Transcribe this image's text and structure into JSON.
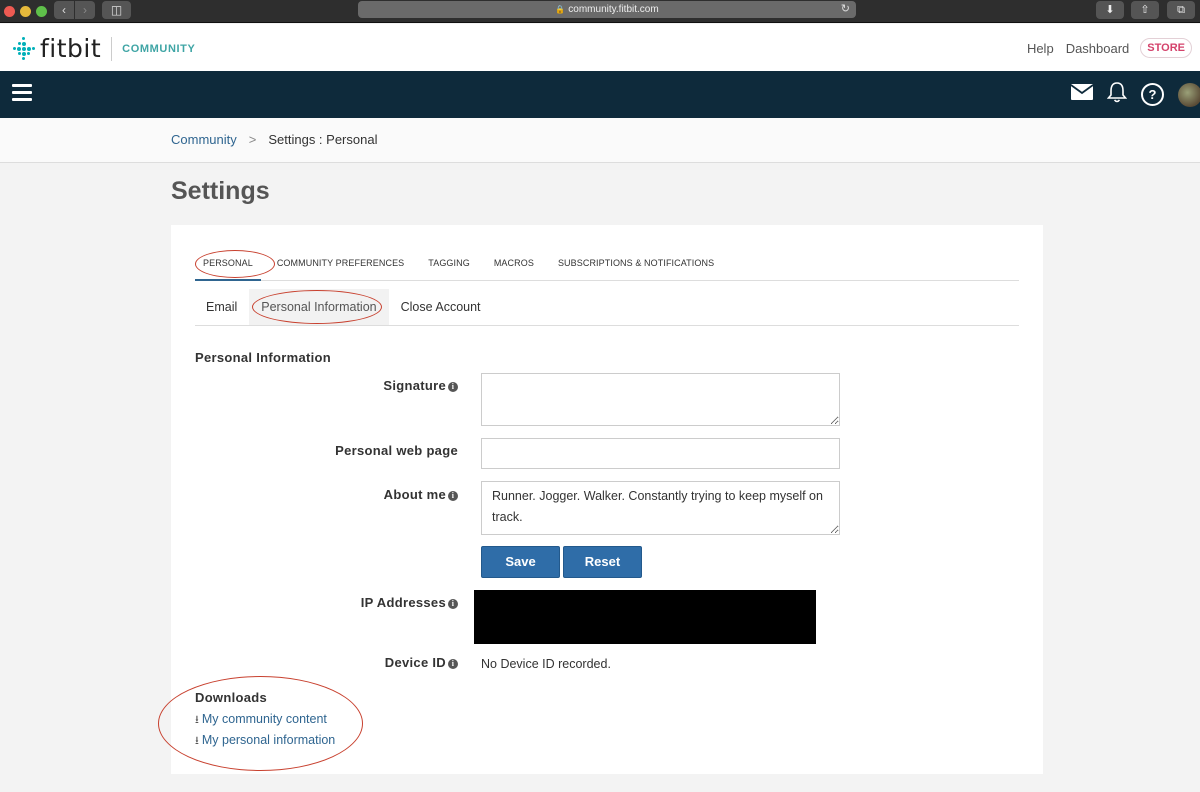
{
  "browser": {
    "url": "community.fitbit.com",
    "lock_icon": "lock-icon",
    "reload_icon": "reload-icon"
  },
  "header": {
    "logo_text": "fitbit",
    "logo_sub": "COMMUNITY",
    "links": [
      "Help",
      "Dashboard"
    ],
    "store_label": "STORE"
  },
  "navbar": {
    "icons": [
      "menu-icon",
      "mail-icon",
      "bell-icon",
      "help-icon",
      "avatar"
    ]
  },
  "breadcrumb": {
    "root": "Community",
    "separator": ">",
    "current": "Settings : Personal"
  },
  "page_title": "Settings",
  "tabs": [
    {
      "label": "PERSONAL",
      "active": true
    },
    {
      "label": "COMMUNITY PREFERENCES",
      "active": false
    },
    {
      "label": "TAGGING",
      "active": false
    },
    {
      "label": "MACROS",
      "active": false
    },
    {
      "label": "SUBSCRIPTIONS & NOTIFICATIONS",
      "active": false
    }
  ],
  "subtabs": [
    {
      "label": "Email",
      "active": false
    },
    {
      "label": "Personal Information",
      "active": true
    },
    {
      "label": "Close Account",
      "active": false
    }
  ],
  "form": {
    "section_title": "Personal Information",
    "signature": {
      "label": "Signature",
      "value": ""
    },
    "web_page": {
      "label": "Personal web page",
      "value": ""
    },
    "about_me": {
      "label": "About me",
      "value": "Runner. Jogger. Walker. Constantly trying to keep myself on track."
    },
    "save_label": "Save",
    "reset_label": "Reset",
    "ip_addresses": {
      "label": "IP Addresses"
    },
    "device_id": {
      "label": "Device ID",
      "value": "No Device ID recorded."
    }
  },
  "downloads": {
    "title": "Downloads",
    "links": [
      "My community content",
      "My personal information"
    ]
  },
  "colors": {
    "navbar": "#0e2a3b",
    "link": "#2f6590",
    "button": "#2f6da8",
    "store": "#d4426b",
    "annotation": "#c8412f"
  }
}
